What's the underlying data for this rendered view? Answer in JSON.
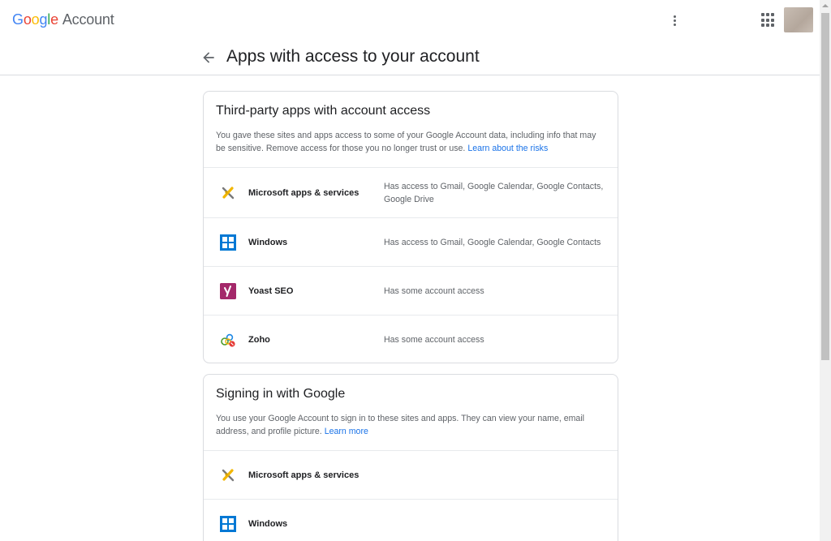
{
  "header": {
    "logo_letters": [
      "G",
      "o",
      "o",
      "g",
      "l",
      "e"
    ],
    "logo_suffix": "Account",
    "more_icon": "more-vert-icon",
    "apps_icon": "apps-grid-icon"
  },
  "page": {
    "title": "Apps with access to your account",
    "back_icon": "arrow-back-icon"
  },
  "third_party": {
    "title": "Third-party apps with account access",
    "description": "You gave these sites and apps access to some of your Google Account data, including info that may be sensitive. Remove access for those you no longer trust or use.",
    "link": "Learn about the risks",
    "apps": [
      {
        "name": "Microsoft apps & services",
        "access": "Has access to Gmail, Google Calendar, Google Contacts, Google Drive",
        "icon": "microsoft-icon"
      },
      {
        "name": "Windows",
        "access": "Has access to Gmail, Google Calendar, Google Contacts",
        "icon": "windows-icon"
      },
      {
        "name": "Yoast SEO",
        "access": "Has some account access",
        "icon": "yoast-icon"
      },
      {
        "name": "Zoho",
        "access": "Has some account access",
        "icon": "zoho-icon"
      }
    ]
  },
  "signing_in": {
    "title": "Signing in with Google",
    "description": "You use your Google Account to sign in to these sites and apps. They can view your name, email address, and profile picture.",
    "link": "Learn more",
    "apps": [
      {
        "name": "Microsoft apps & services",
        "icon": "microsoft-icon"
      },
      {
        "name": "Windows",
        "icon": "windows-icon"
      }
    ]
  },
  "colors": {
    "link": "#1a73e8",
    "text_primary": "#202124",
    "text_secondary": "#5f6368",
    "border": "#dadce0"
  }
}
